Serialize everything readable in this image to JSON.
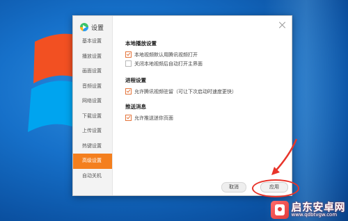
{
  "dialog": {
    "title": "设置",
    "logo_icon": "tencent-video-logo-icon",
    "close_icon": "close-icon"
  },
  "sidebar": {
    "items": [
      {
        "label": "基本设置",
        "active": false
      },
      {
        "label": "播放设置",
        "active": false
      },
      {
        "label": "画面设置",
        "active": false
      },
      {
        "label": "音频设置",
        "active": false
      },
      {
        "label": "网络设置",
        "active": false
      },
      {
        "label": "下载设置",
        "active": false
      },
      {
        "label": "上传设置",
        "active": false
      },
      {
        "label": "热键设置",
        "active": false
      },
      {
        "label": "高级设置",
        "active": true
      },
      {
        "label": "自动关机",
        "active": false
      }
    ],
    "active_color": "#f47f1e"
  },
  "sections": [
    {
      "title": "本地播放设置",
      "options": [
        {
          "label": "本地视频默认用腾讯视频打开",
          "checked": true
        },
        {
          "label": "关闭本地视频后自动打开主界面",
          "checked": false
        }
      ]
    },
    {
      "title": "进程设置",
      "options": [
        {
          "label": "允许腾讯视频驻留（可让下次启动时速度更快）",
          "checked": true
        }
      ]
    },
    {
      "title": "推送消息",
      "options": [
        {
          "label": "允许推送迷你页面",
          "checked": true
        }
      ]
    }
  ],
  "buttons": {
    "cancel_label": "取消",
    "apply_label": "应用"
  },
  "watermark": {
    "title": "启东安卓网",
    "url": "www.qdbtvgw.com"
  }
}
